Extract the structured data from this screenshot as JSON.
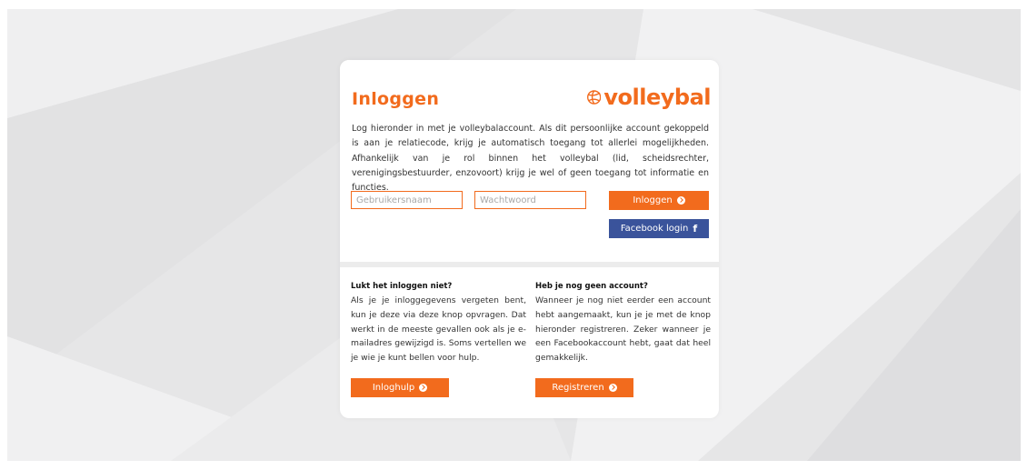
{
  "card": {
    "title": "Inloggen",
    "logo_text": "volleybal",
    "intro": "Log hieronder in met je volleybalaccount. Als dit persoonlijke account gekoppeld is aan je relatiecode, krijg je automatisch toegang tot allerlei mogelijkheden. Afhankelijk van je rol binnen het volleybal (lid, scheidsrechter, verenigingsbestuurder, enzovoort) krijg je wel of geen toegang tot informatie en functies."
  },
  "form": {
    "username_placeholder": "Gebruikersnaam",
    "password_placeholder": "Wachtwoord",
    "login_label": "Inloggen",
    "facebook_label": "Facebook login"
  },
  "help": {
    "heading": "Lukt het inloggen niet?",
    "text": "Als je je inloggegevens vergeten bent, kun je deze via deze knop opvragen. Dat werkt in de meeste gevallen ook als je e-mailadres gewijzigd is. Soms vertellen we je wie je kunt bellen voor hulp.",
    "button_label": "Inloghulp"
  },
  "register": {
    "heading": "Heb je nog geen account?",
    "text": "Wanneer je nog niet eerder een account hebt aangemaakt, kun je je met de knop hieronder registreren. Zeker wanneer je een Facebookaccount hebt, gaat dat heel gemakkelijk.",
    "button_label": "Registreren"
  },
  "colors": {
    "accent": "#f26b1d",
    "facebook": "#3a539b",
    "background": "#e9e9ea"
  },
  "icons": {
    "logo": "volleyball-icon",
    "arrow": "arrow-circle-right-icon",
    "facebook": "facebook-f-icon"
  }
}
